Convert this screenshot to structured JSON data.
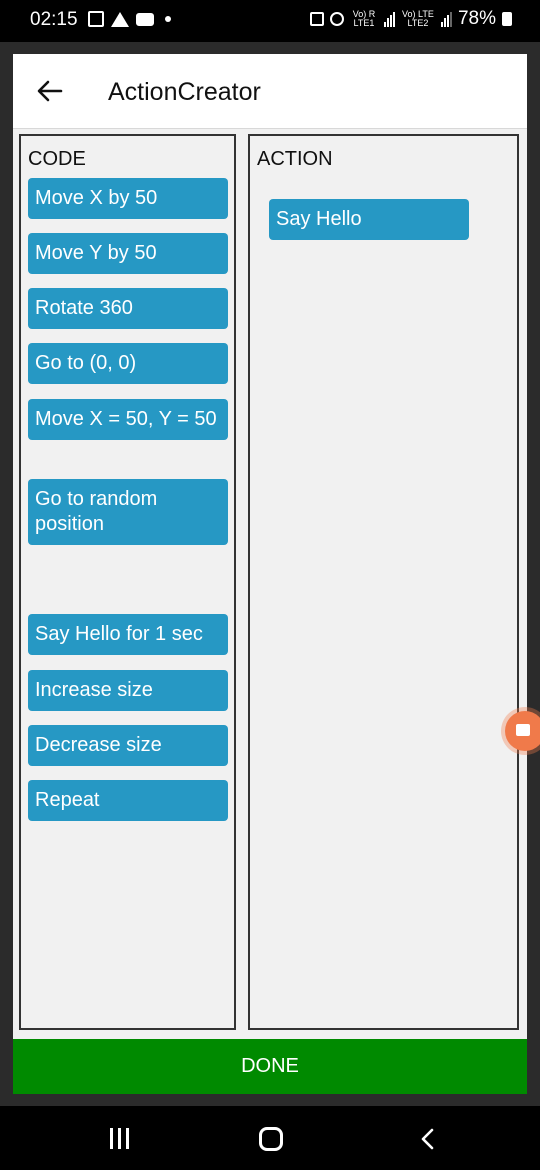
{
  "status_bar": {
    "time": "02:15",
    "sim1_label": "Vo) R LTE1",
    "sim2_label": "Vo) LTE LTE2",
    "battery": "78%"
  },
  "app_bar": {
    "title": "ActionCreator"
  },
  "code_panel": {
    "header": "CODE",
    "blocks": [
      "Move X by 50",
      "Move Y by 50",
      "Rotate 360",
      "Go to (0, 0)",
      "Move X = 50, Y = 50",
      "Go to random position",
      "Say Hello for 1 sec",
      "Increase size",
      "Decrease size",
      "Repeat"
    ]
  },
  "action_panel": {
    "header": "ACTION",
    "blocks": [
      "Say Hello"
    ]
  },
  "footer": {
    "done_label": "DONE"
  },
  "colors": {
    "block": "#2698c4",
    "done": "#008a00",
    "background": "#f1f1f1"
  },
  "icons": {
    "back": "arrow-left-icon",
    "nav_recent": "recent-apps-icon",
    "nav_home": "home-icon",
    "nav_back": "chevron-left-icon"
  }
}
